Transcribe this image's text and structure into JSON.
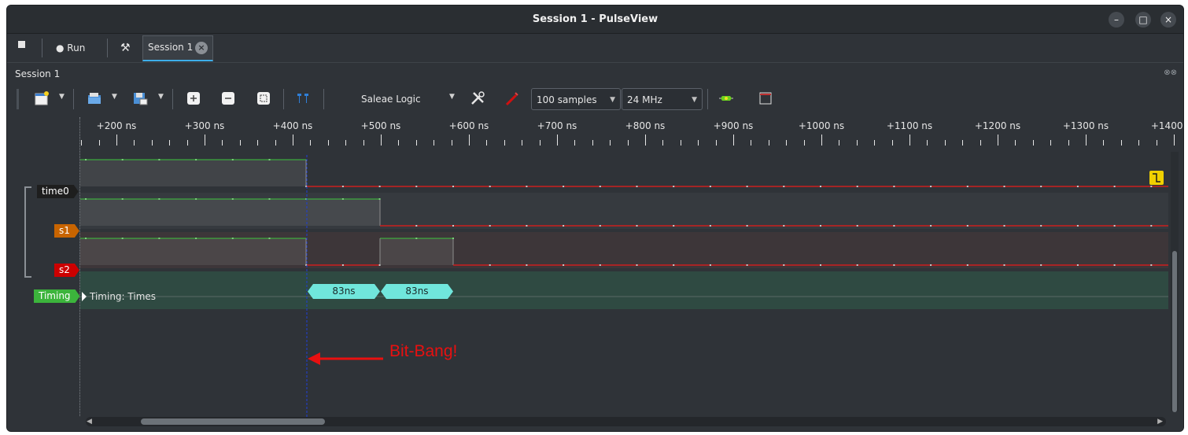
{
  "window": {
    "title": "Session 1 - PulseView",
    "controls": [
      "–",
      "□",
      "×"
    ]
  },
  "tabbar": {
    "stop_icon": "stop-icon",
    "run_label": "● Run",
    "settings_icon": "wrench-icon",
    "session_tab": "Session 1",
    "close_icon": "close-icon"
  },
  "dock": {
    "title": "Session 1",
    "controls": "⊗⊗"
  },
  "toolbar": {
    "device": "Saleae Logic",
    "samples": "100  samples",
    "samplerate": "24 MHz",
    "icons": [
      "new-session-icon",
      "open-file-icon",
      "save-icon",
      "zoom-in-icon",
      "zoom-out-icon",
      "zoom-fit-icon",
      "cursor-icon",
      "device-config-icon",
      "probe-icon",
      "decoder-icon",
      "math-icon"
    ]
  },
  "ruler": {
    "labels": [
      "+200 ns",
      "+300 ns",
      "+400 ns",
      "+500 ns",
      "+600 ns",
      "+700 ns",
      "+800 ns",
      "+900 ns",
      "+1000 ns",
      "+1100 ns",
      "+1200 ns",
      "+1300 ns",
      "+1400 ns"
    ]
  },
  "channels": [
    {
      "name": "time0",
      "color": "#1e1e1e"
    },
    {
      "name": "s1",
      "color": "#c86400"
    },
    {
      "name": "s2",
      "color": "#cc0000"
    }
  ],
  "decoder": {
    "tag": "Timing",
    "tag_color": "#3cb43c",
    "label": "Timing: Times",
    "annotations": [
      "83ns",
      "83ns"
    ],
    "annotation_color": "#70e6dc"
  },
  "annotation_text": "Bit-Bang!",
  "colors": {
    "high_line": "#3cc43c",
    "low_line": "#cc1f1f",
    "cursor": "#1f3fd8",
    "arrow": "#e81010"
  }
}
